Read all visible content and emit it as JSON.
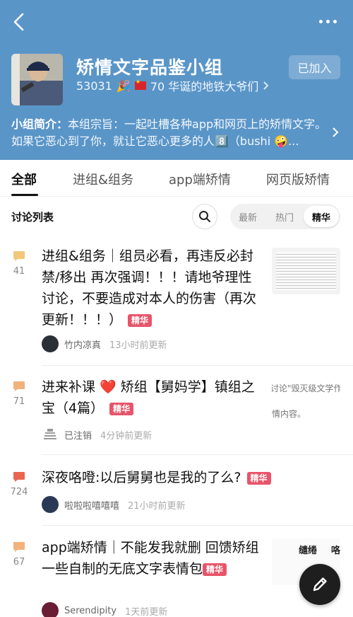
{
  "header": {
    "title": "矫情文字品鉴小组",
    "member_count": "53031",
    "member_badge_text": "70 华诞的地铁大爷们",
    "join_button": "已加入",
    "intro_label": "小组简介：",
    "intro_text": "本组宗旨：一起吐槽各种app和网页上的矫情文字。如果它恶心到了你，就让它恶心更多的人8️⃣（bushi 🤪...",
    "bg_color": "#5a95c8"
  },
  "tabs": [
    {
      "label": "全部"
    },
    {
      "label": "进组&组务"
    },
    {
      "label": "app端矫情"
    },
    {
      "label": "网页版矫情"
    }
  ],
  "discussion": {
    "label": "讨论列表",
    "filters": [
      "最新",
      "热门",
      "精华"
    ],
    "selected_filter": "精华"
  },
  "posts": [
    {
      "count": "41",
      "title": "进组&组务｜组员必看，再违反必封禁/移出  再次强调！！！请地爷理性讨论，不要造成对本人的伤害（再次更新！！！）",
      "tag": "精华",
      "author": "竹内凉真",
      "time": "13小时前更新",
      "bubble_color": "#f2c77b"
    },
    {
      "count": "71",
      "title": "进来补课 ❤️ 矫组【舅妈学】镇组之宝（4篇）",
      "tag": "精华",
      "author": "已注销",
      "time": "4分钟前更新",
      "bubble_color": "#f2b27b",
      "thumb_line1": "讨论\"毁灭级文学作品",
      "thumb_line2": "情内容。"
    },
    {
      "count": "724",
      "title": "深夜咯噔:以后舅舅也是我的了么?",
      "tag": "精华",
      "author": "啦啦啦嘻嘻嘻",
      "time": "21小时前更新",
      "bubble_color": "#e8654f"
    },
    {
      "count": "67",
      "title": "app端矫情｜不能发我就删 回馈矫组 一些自制的无底文字表情包",
      "tag": "精华",
      "author": "Serendipity",
      "time": "1天前更新",
      "bubble_color": "#f2b27b",
      "thumb_words": [
        "缱绻",
        "咯"
      ]
    }
  ]
}
